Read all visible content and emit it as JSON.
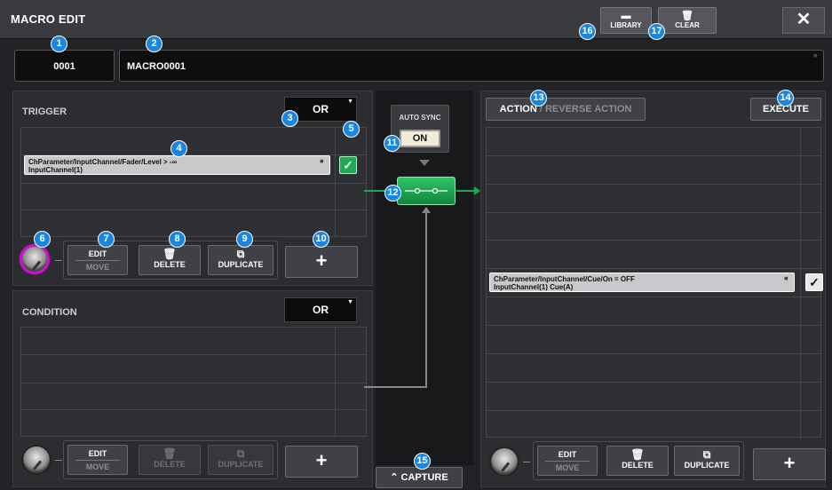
{
  "window": {
    "title": "MACRO EDIT",
    "library_label": "LIBRARY",
    "clear_label": "CLEAR",
    "close_glyph": "✕"
  },
  "macro": {
    "number": "0001",
    "name": "MACRO0001"
  },
  "trigger": {
    "title": "TRIGGER",
    "mode": "OR",
    "slot_line1": "ChParameter/InputChannel/Fader/Level > -∞",
    "slot_line2": "InputChannel(1)"
  },
  "condition": {
    "title": "CONDITION",
    "mode": "OR"
  },
  "center": {
    "autosync_label": "AUTO SYNC",
    "autosync_value": "ON",
    "capture_label": "CAPTURE"
  },
  "action": {
    "action_label": "ACTION",
    "reverse_label": "/ REVERSE ACTION",
    "execute_label": "EXECUTE",
    "slot_line1": "ChParameter/InputChannel/Cue/On = OFF",
    "slot_line2": "InputChannel(1) Cue(A)"
  },
  "buttons": {
    "edit": "EDIT",
    "move": "MOVE",
    "delete": "DELETE",
    "duplicate": "DUPLICATE",
    "plus": "+"
  },
  "icons": {
    "folder": "folder-icon",
    "trash": "trash-icon",
    "duplicate": "duplicate-icon",
    "check": "check-icon",
    "close": "close-icon"
  },
  "colors": {
    "accent_green": "#1fa954",
    "knob_ring": "#c418c8",
    "badge_blue": "#1a86e0"
  },
  "badges": [
    "1",
    "2",
    "3",
    "4",
    "5",
    "6",
    "7",
    "8",
    "9",
    "10",
    "11",
    "12",
    "13",
    "14",
    "15",
    "16",
    "17"
  ]
}
